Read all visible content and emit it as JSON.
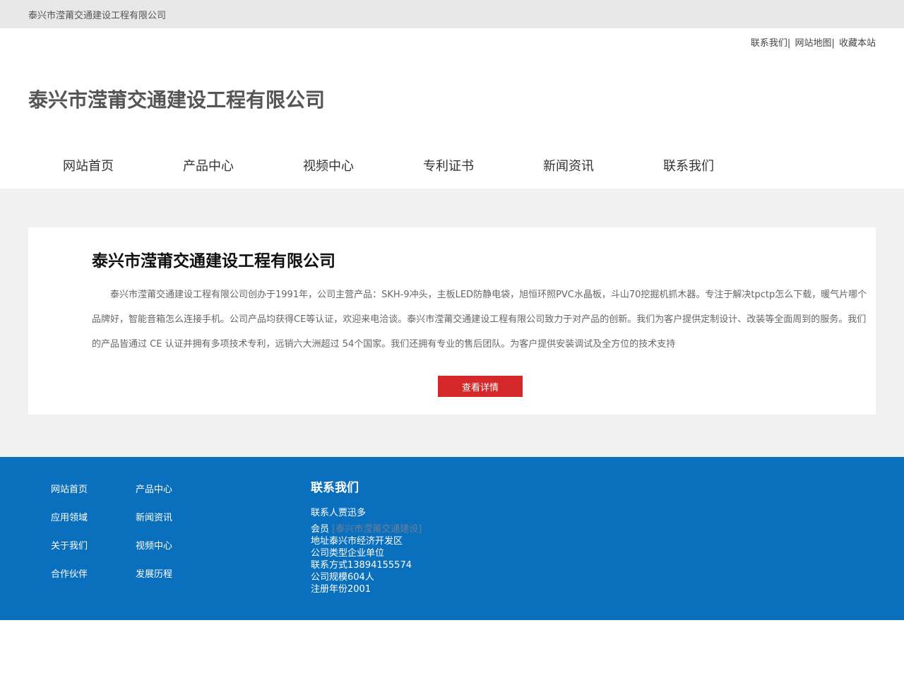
{
  "topbar": {
    "company": "泰兴市滢莆交通建设工程有限公司"
  },
  "header": {
    "links": [
      "联系我们",
      "网站地图",
      "收藏本站"
    ],
    "site_title": "泰兴市滢莆交通建设工程有限公司"
  },
  "nav": [
    "网站首页",
    "产品中心",
    "视频中心",
    "专利证书",
    "新闻资讯",
    "联系我们"
  ],
  "intro": {
    "title": "泰兴市滢莆交通建设工程有限公司",
    "description": "泰兴市滢莆交通建设工程有限公司创办于1991年，公司主营产品：SKH-9冲头，主板LED防静电袋，旭恒环照PVC水晶板，斗山70挖掘机抓木器。专注于解决tpctp怎么下载，暖气片哪个品牌好，智能音箱怎么连接手机。公司产品均获得CE等认证，欢迎来电洽谈。泰兴市滢莆交通建设工程有限公司致力于对产品的创新。我们为客户提供定制设计、改装等全面周到的服务。我们的产品皆通过 CE 认证并拥有多项技术专利，远销六大洲超过 54个国家。我们还拥有专业的售后团队。为客户提供安装调试及全方位的技术支持",
    "button": "查看详情"
  },
  "footer": {
    "links": [
      "网站首页",
      "产品中心",
      "应用领域",
      "新闻资讯",
      "关于我们",
      "视频中心",
      "合作伙伴",
      "发展历程"
    ],
    "contact": {
      "heading": "联系我们",
      "person": "联系人贾迅多",
      "member_label": "会员",
      "member_value": "[泰兴市滢莆交通建设]",
      "address": "地址泰兴市经济开发区",
      "company_type": "公司类型企业单位",
      "phone": "联系方式13894155574",
      "scale": "公司规模604人",
      "founded": "注册年份2001"
    }
  }
}
